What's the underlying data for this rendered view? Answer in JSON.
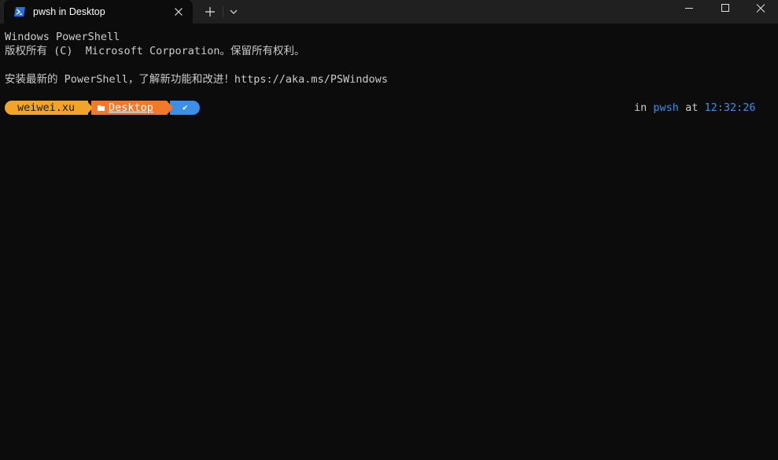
{
  "tab": {
    "title": "pwsh in Desktop",
    "icon": "powershell-icon"
  },
  "titlebar": {
    "new_tab": "+",
    "dropdown": "chevron-down-icon"
  },
  "terminal": {
    "lines": [
      "Windows PowerShell",
      "版权所有 (C)  Microsoft Corporation。保留所有权利。",
      "安装最新的 PowerShell，了解新功能和改进！https://aka.ms/PSWindows"
    ],
    "prompt": {
      "user": "weiwei.xu",
      "path": "Desktop",
      "status": "✔",
      "in_label": "in",
      "shell": "pwsh",
      "at_label": "at",
      "time": "12:32:26"
    }
  },
  "colors": {
    "background": "#0c0c0c",
    "titlebar": "#202020",
    "user_segment": "#f1a42a",
    "path_segment": "#f2792a",
    "status_segment": "#3b8fe6",
    "accent_text": "#3b8fe6"
  }
}
